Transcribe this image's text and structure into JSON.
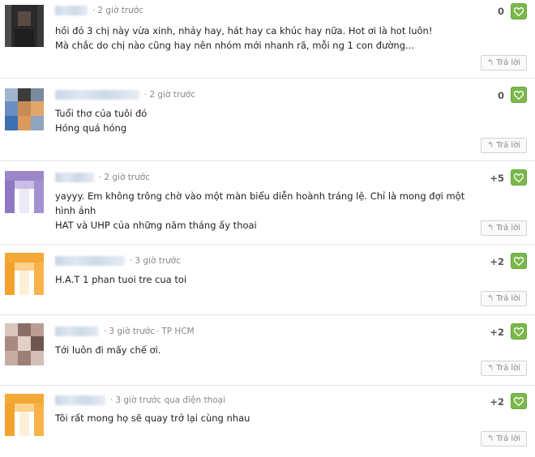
{
  "comments": [
    {
      "time": "2 giờ trước",
      "location": "",
      "lines": [
        "hồi đó 3 chị này vừa xinh, nhảy hay, hát hay ca khúc hay nữa. Hot ơi là hot luôn!",
        "Mà chắc do chị nào cũng hay nên nhóm mới nhanh rã, mỗi ng 1 con đường..."
      ],
      "score": "0",
      "reply_label": "Trả lời",
      "avatar": "dark"
    },
    {
      "time": "2 giờ trước",
      "location": "",
      "lines": [
        "Tuổi thơ của tuôi đó",
        "Hóng quá hóng"
      ],
      "score": "0",
      "reply_label": "Trả lời",
      "avatar": "photo"
    },
    {
      "time": "2 giờ trước",
      "location": "",
      "lines": [
        "yayyy. Em không trông chờ vào một màn biểu diễn hoành tráng lệ. Chỉ là mong đợi một hình ảnh",
        "HAT và UHP của những năm tháng ấy thoai"
      ],
      "score": "+5",
      "reply_label": "Trả lời",
      "avatar": "purple"
    },
    {
      "time": "3 giờ trước",
      "location": "",
      "lines": [
        "H.A.T 1 phan tuoi tre cua toi"
      ],
      "score": "+2",
      "reply_label": "Trả lời",
      "avatar": "orange"
    },
    {
      "time": "3 giờ trước",
      "location": "TP HCM",
      "lines": [
        "Tới luôn đi mấy chế ơi."
      ],
      "score": "+2",
      "reply_label": "Trả lời",
      "avatar": "face"
    },
    {
      "time": "3 giờ trước qua điện thoại",
      "location": "",
      "lines": [
        "Tôi rất mong họ sẽ quay trở lại cùng nhau"
      ],
      "score": "+2",
      "reply_label": "Trả lời",
      "avatar": "orange"
    }
  ],
  "colors": {
    "like_green": "#7ab84a",
    "meta_gray": "#888888",
    "divider": "#e4e4e4"
  },
  "icons": {
    "like": "heart-icon",
    "reply": "reply-arrow-icon"
  }
}
